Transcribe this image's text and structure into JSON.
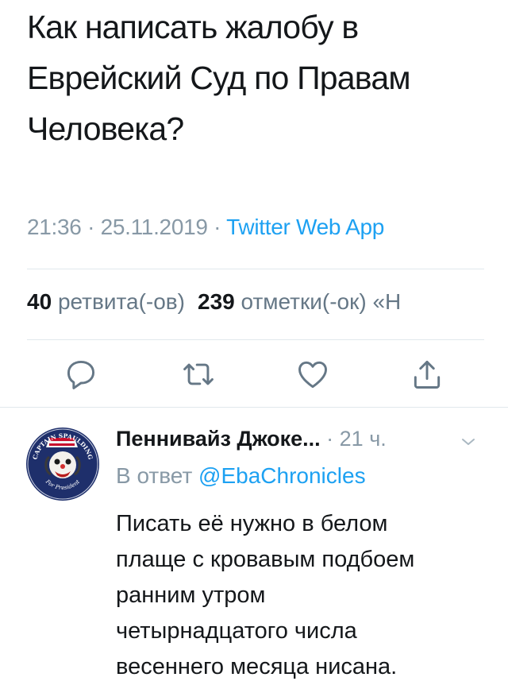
{
  "tweet": {
    "text": "Как написать жалобу в Еврейский Суд по Правам Человека?",
    "time": "21:36",
    "separator": "·",
    "date": "25.11.2019",
    "app": "Twitter Web App"
  },
  "stats": {
    "retweets_count": "40",
    "retweets_label": "ретвита(-ов)",
    "likes_count": "239",
    "likes_label": "отметки(-ок)",
    "extra": "«Н"
  },
  "actions": [
    {
      "icon": "reply-icon"
    },
    {
      "icon": "retweet-icon"
    },
    {
      "icon": "heart-icon"
    },
    {
      "icon": "share-icon"
    }
  ],
  "reply": {
    "author": "Пеннивайз Джоке...",
    "time": "· 21 ч.",
    "reply_prefix": "В ответ",
    "reply_handle": "@EbaChronicles",
    "avatar_text_top": "CAPTAIN SPAULDING",
    "avatar_text_bottom": "For President",
    "lines": [
      "Писать её нужно в белом",
      "плаще с кровавым подбоем",
      "ранним утром",
      "четырнадцатого числа",
      "весеннего месяца нисана."
    ]
  },
  "colors": {
    "accent": "#1da1f2",
    "text": "#14171a",
    "muted": "#8899a6",
    "divider": "#e1e8ed"
  }
}
